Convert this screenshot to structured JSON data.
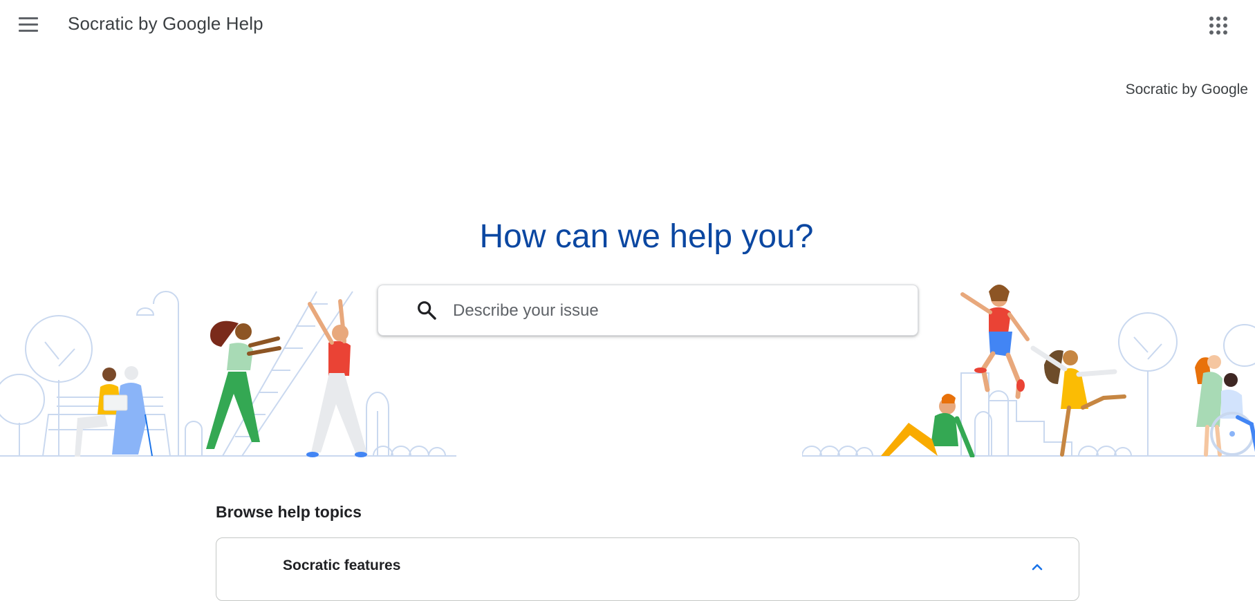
{
  "header": {
    "app_title": "Socratic by Google Help",
    "menu_icon": "hamburger-menu-icon",
    "apps_icon": "google-apps-grid-icon"
  },
  "product_link": "Socratic by Google",
  "hero": {
    "title": "How can we help you?",
    "search_placeholder": "Describe your issue",
    "search_icon": "search-icon"
  },
  "browse": {
    "title": "Browse help topics",
    "topics": [
      {
        "label": "Socratic features",
        "expanded": true
      }
    ]
  },
  "colors": {
    "hero_title": "#0b47a1",
    "chevron": "#1a73e8",
    "illustration_lines": "#c9d8ef"
  }
}
